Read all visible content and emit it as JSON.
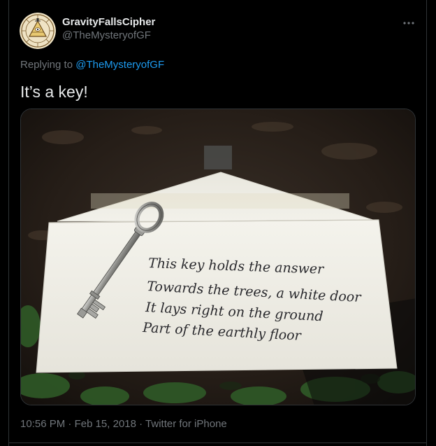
{
  "tweet": {
    "display_name": "GravityFallsCipher",
    "handle": "@TheMysteryofGF",
    "replying_prefix": "Replying to ",
    "replying_to": "@TheMysteryofGF",
    "text": "It’s a key!",
    "time": "10:56 PM",
    "date": "Feb 15, 2018",
    "separator": " · ",
    "source": "Twitter for iPhone",
    "more_icon": "more-horizontal-icon",
    "avatar_icon": "bill-cipher-avatar"
  },
  "photo": {
    "note_lines": [
      "This key holds the answer",
      "Towards the trees, a white door",
      "It lays right on the ground",
      "Part of the earthly floor"
    ]
  },
  "colors": {
    "background": "#000000",
    "text": "#e7e9ea",
    "secondary": "#71767b",
    "accent": "#1d9bf0",
    "border": "#2f3336"
  }
}
